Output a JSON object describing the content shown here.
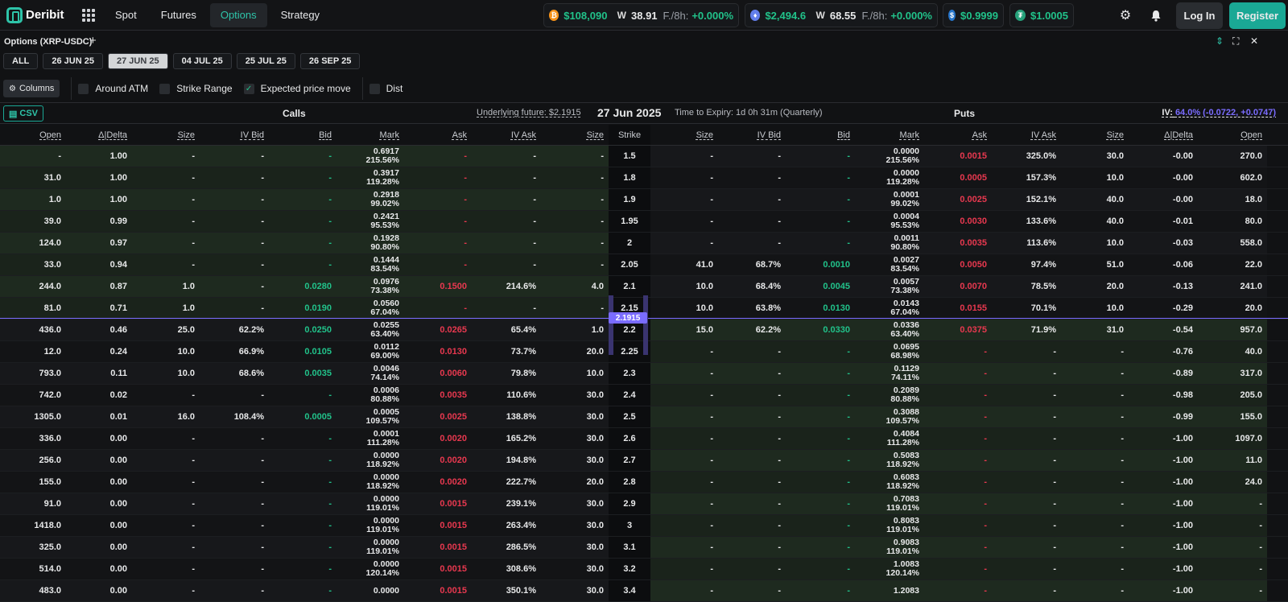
{
  "app": {
    "name": "Deribit"
  },
  "nav": [
    {
      "label": "Spot"
    },
    {
      "label": "Futures"
    },
    {
      "label": "Options",
      "active": true
    },
    {
      "label": "Strategy"
    }
  ],
  "tickers": {
    "btc": {
      "price": "$108,090",
      "vol": "38.91",
      "funding_label": "F./8h:",
      "funding": "+0.000%"
    },
    "eth": {
      "price": "$2,494.6",
      "vol": "68.55",
      "funding_label": "F./8h:",
      "funding": "+0.000%"
    },
    "usdc": {
      "price": "$0.9999"
    },
    "usdt": {
      "price": "$1.0005"
    }
  },
  "auth": {
    "login": "Log In",
    "register": "Register"
  },
  "panel": {
    "title": "Options (XRP-USDC)",
    "plus": "+"
  },
  "expiries": [
    "ALL",
    "26 JUN 25",
    "27 JUN 25",
    "04 JUL 25",
    "25 JUL 25",
    "26 SEP 25"
  ],
  "active_expiry": "27 JUN 25",
  "options_bar": {
    "columns_label": "Columns",
    "toggles": [
      {
        "label": "Around ATM",
        "checked": false
      },
      {
        "label": "Strike Range",
        "checked": false
      },
      {
        "label": "Expected price move",
        "checked": true
      },
      {
        "label": "Dist",
        "checked": false
      }
    ]
  },
  "info": {
    "csv": "CSV",
    "calls": "Calls",
    "underlying": "Underlying future: $2.1915",
    "date": "27 Jun 2025",
    "time_to_expiry": "Time to Expiry: 1d 0h 31m (Quarterly)",
    "puts": "Puts",
    "iv_label": "IV:",
    "iv_value": "64.0% (-0.0722, +0.0747)"
  },
  "headers": {
    "calls": [
      "Open",
      "Δ|Delta",
      "Size",
      "IV Bid",
      "Bid",
      "Mark",
      "Ask",
      "IV Ask",
      "Size"
    ],
    "strike": "Strike",
    "puts": [
      "Size",
      "IV Bid",
      "Bid",
      "Mark",
      "Ask",
      "IV Ask",
      "Size",
      "Δ|Delta",
      "Open"
    ]
  },
  "atm_price": "2.1915",
  "colors": {
    "accent": "#2ec4a9",
    "green": "#21c28a",
    "red": "#e8384f",
    "purple": "#7a6cff"
  },
  "rows": [
    {
      "c": [
        "-",
        "1.00",
        "-",
        "-",
        "-",
        "0.6917",
        "215.56%",
        "-",
        "-",
        "-"
      ],
      "k": "1.5",
      "p": [
        "-",
        "-",
        "-",
        "0.0000",
        "215.56%",
        "0.0015",
        "325.0%",
        "30.0",
        "-0.00",
        "270.0"
      ]
    },
    {
      "c": [
        "31.0",
        "1.00",
        "-",
        "-",
        "-",
        "0.3917",
        "119.28%",
        "-",
        "-",
        "-"
      ],
      "k": "1.8",
      "p": [
        "-",
        "-",
        "-",
        "0.0000",
        "119.28%",
        "0.0005",
        "157.3%",
        "10.0",
        "-0.00",
        "602.0"
      ]
    },
    {
      "c": [
        "1.0",
        "1.00",
        "-",
        "-",
        "-",
        "0.2918",
        "99.02%",
        "-",
        "-",
        "-"
      ],
      "k": "1.9",
      "p": [
        "-",
        "-",
        "-",
        "0.0001",
        "99.02%",
        "0.0025",
        "152.1%",
        "40.0",
        "-0.00",
        "18.0"
      ]
    },
    {
      "c": [
        "39.0",
        "0.99",
        "-",
        "-",
        "-",
        "0.2421",
        "95.53%",
        "-",
        "-",
        "-"
      ],
      "k": "1.95",
      "p": [
        "-",
        "-",
        "-",
        "0.0004",
        "95.53%",
        "0.0030",
        "133.6%",
        "40.0",
        "-0.01",
        "80.0"
      ]
    },
    {
      "c": [
        "124.0",
        "0.97",
        "-",
        "-",
        "-",
        "0.1928",
        "90.80%",
        "-",
        "-",
        "-"
      ],
      "k": "2",
      "p": [
        "-",
        "-",
        "-",
        "0.0011",
        "90.80%",
        "0.0035",
        "113.6%",
        "10.0",
        "-0.03",
        "558.0"
      ]
    },
    {
      "c": [
        "33.0",
        "0.94",
        "-",
        "-",
        "-",
        "0.1444",
        "83.54%",
        "-",
        "-",
        "-"
      ],
      "k": "2.05",
      "p": [
        "41.0",
        "68.7%",
        "0.0010",
        "0.0027",
        "83.54%",
        "0.0050",
        "97.4%",
        "51.0",
        "-0.06",
        "22.0"
      ]
    },
    {
      "c": [
        "244.0",
        "0.87",
        "1.0",
        "-",
        "0.0280",
        "0.0976",
        "73.38%",
        "0.1500",
        "214.6%",
        "4.0"
      ],
      "k": "2.1",
      "p": [
        "10.0",
        "68.4%",
        "0.0045",
        "0.0057",
        "73.38%",
        "0.0070",
        "78.5%",
        "20.0",
        "-0.13",
        "241.0"
      ]
    },
    {
      "c": [
        "81.0",
        "0.71",
        "1.0",
        "-",
        "0.0190",
        "0.0560",
        "67.04%",
        "-",
        "-",
        "-"
      ],
      "k": "2.15",
      "p": [
        "10.0",
        "63.8%",
        "0.0130",
        "0.0143",
        "67.04%",
        "0.0155",
        "70.1%",
        "10.0",
        "-0.29",
        "20.0"
      ]
    },
    {
      "c": [
        "436.0",
        "0.46",
        "25.0",
        "62.2%",
        "0.0250",
        "0.0255",
        "63.40%",
        "0.0265",
        "65.4%",
        "1.0"
      ],
      "k": "2.2",
      "p": [
        "15.0",
        "62.2%",
        "0.0330",
        "0.0336",
        "63.40%",
        "0.0375",
        "71.9%",
        "31.0",
        "-0.54",
        "957.0"
      ]
    },
    {
      "c": [
        "12.0",
        "0.24",
        "10.0",
        "66.9%",
        "0.0105",
        "0.0112",
        "69.00%",
        "0.0130",
        "73.7%",
        "20.0"
      ],
      "k": "2.25",
      "p": [
        "-",
        "-",
        "-",
        "0.0695",
        "68.98%",
        "-",
        "-",
        "-",
        "-0.76",
        "40.0"
      ]
    },
    {
      "c": [
        "793.0",
        "0.11",
        "10.0",
        "68.6%",
        "0.0035",
        "0.0046",
        "74.14%",
        "0.0060",
        "79.8%",
        "10.0"
      ],
      "k": "2.3",
      "p": [
        "-",
        "-",
        "-",
        "0.1129",
        "74.11%",
        "-",
        "-",
        "-",
        "-0.89",
        "317.0"
      ]
    },
    {
      "c": [
        "742.0",
        "0.02",
        "-",
        "-",
        "-",
        "0.0006",
        "80.88%",
        "0.0035",
        "110.6%",
        "30.0"
      ],
      "k": "2.4",
      "p": [
        "-",
        "-",
        "-",
        "0.2089",
        "80.88%",
        "-",
        "-",
        "-",
        "-0.98",
        "205.0"
      ]
    },
    {
      "c": [
        "1305.0",
        "0.01",
        "16.0",
        "108.4%",
        "0.0005",
        "0.0005",
        "109.57%",
        "0.0025",
        "138.8%",
        "30.0"
      ],
      "k": "2.5",
      "p": [
        "-",
        "-",
        "-",
        "0.3088",
        "109.57%",
        "-",
        "-",
        "-",
        "-0.99",
        "155.0"
      ]
    },
    {
      "c": [
        "336.0",
        "0.00",
        "-",
        "-",
        "-",
        "0.0001",
        "111.28%",
        "0.0020",
        "165.2%",
        "30.0"
      ],
      "k": "2.6",
      "p": [
        "-",
        "-",
        "-",
        "0.4084",
        "111.28%",
        "-",
        "-",
        "-",
        "-1.00",
        "1097.0"
      ]
    },
    {
      "c": [
        "256.0",
        "0.00",
        "-",
        "-",
        "-",
        "0.0000",
        "118.92%",
        "0.0020",
        "194.8%",
        "30.0"
      ],
      "k": "2.7",
      "p": [
        "-",
        "-",
        "-",
        "0.5083",
        "118.92%",
        "-",
        "-",
        "-",
        "-1.00",
        "11.0"
      ]
    },
    {
      "c": [
        "155.0",
        "0.00",
        "-",
        "-",
        "-",
        "0.0000",
        "118.92%",
        "0.0020",
        "222.7%",
        "20.0"
      ],
      "k": "2.8",
      "p": [
        "-",
        "-",
        "-",
        "0.6083",
        "118.92%",
        "-",
        "-",
        "-",
        "-1.00",
        "24.0"
      ]
    },
    {
      "c": [
        "91.0",
        "0.00",
        "-",
        "-",
        "-",
        "0.0000",
        "119.01%",
        "0.0015",
        "239.1%",
        "30.0"
      ],
      "k": "2.9",
      "p": [
        "-",
        "-",
        "-",
        "0.7083",
        "119.01%",
        "-",
        "-",
        "-",
        "-1.00",
        "-"
      ]
    },
    {
      "c": [
        "1418.0",
        "0.00",
        "-",
        "-",
        "-",
        "0.0000",
        "119.01%",
        "0.0015",
        "263.4%",
        "30.0"
      ],
      "k": "3",
      "p": [
        "-",
        "-",
        "-",
        "0.8083",
        "119.01%",
        "-",
        "-",
        "-",
        "-1.00",
        "-"
      ]
    },
    {
      "c": [
        "325.0",
        "0.00",
        "-",
        "-",
        "-",
        "0.0000",
        "119.01%",
        "0.0015",
        "286.5%",
        "30.0"
      ],
      "k": "3.1",
      "p": [
        "-",
        "-",
        "-",
        "0.9083",
        "119.01%",
        "-",
        "-",
        "-",
        "-1.00",
        "-"
      ]
    },
    {
      "c": [
        "514.0",
        "0.00",
        "-",
        "-",
        "-",
        "0.0000",
        "120.14%",
        "0.0015",
        "308.6%",
        "30.0"
      ],
      "k": "3.2",
      "p": [
        "-",
        "-",
        "-",
        "1.0083",
        "120.14%",
        "-",
        "-",
        "-",
        "-1.00",
        "-"
      ]
    },
    {
      "c": [
        "483.0",
        "0.00",
        "-",
        "-",
        "-",
        "0.0000",
        "",
        "0.0015",
        "350.1%",
        "30.0"
      ],
      "k": "3.4",
      "p": [
        "-",
        "-",
        "-",
        "1.2083",
        "",
        "-",
        "-",
        "-",
        "-1.00",
        "-"
      ]
    }
  ]
}
